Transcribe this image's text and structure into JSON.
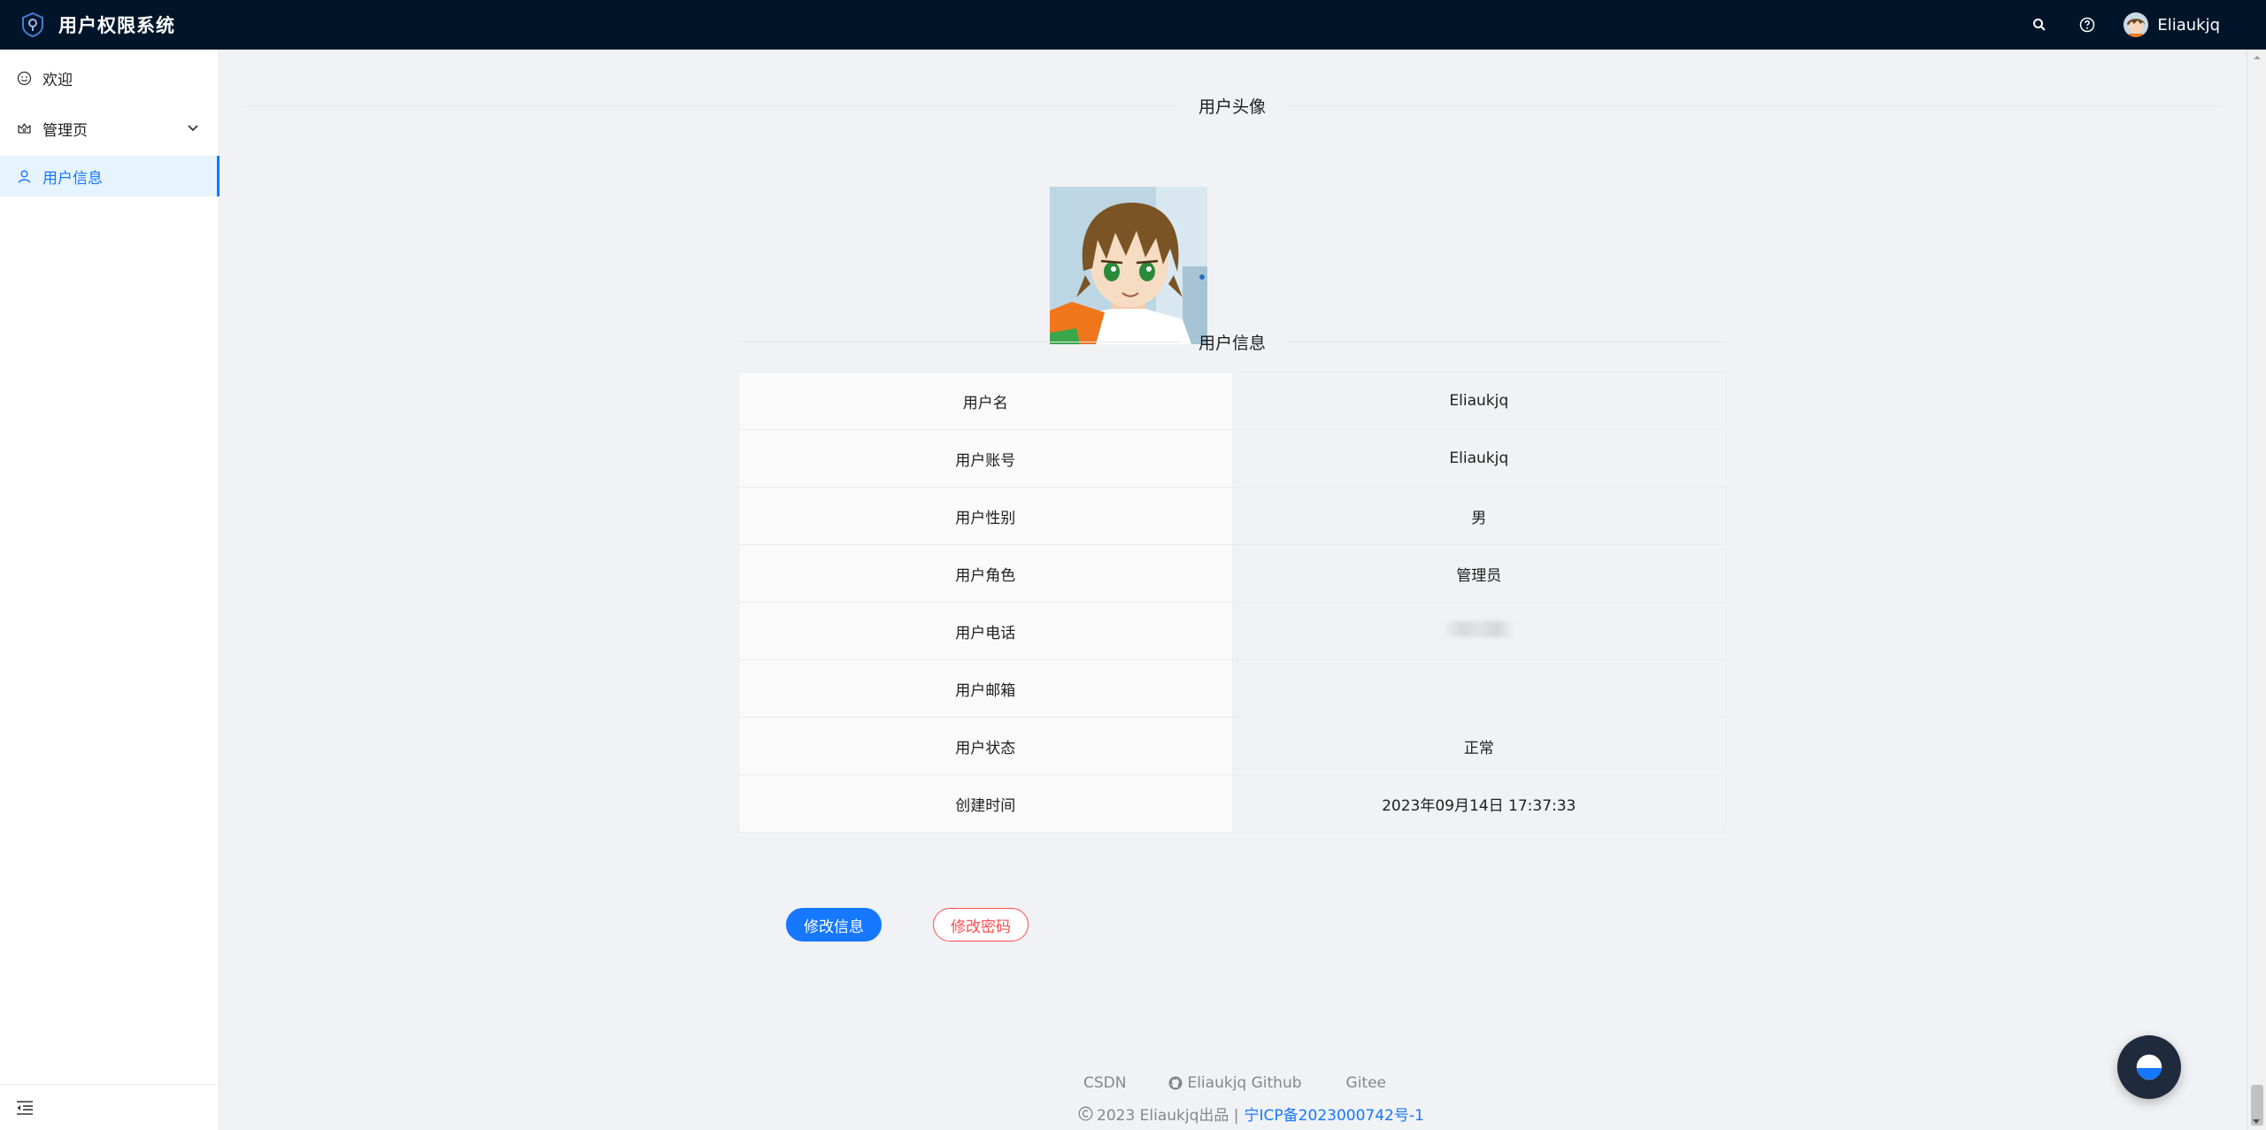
{
  "header": {
    "title": "用户权限系统",
    "icons": [
      "search-icon",
      "question-circle-icon"
    ],
    "user_name": "Eliaukjq"
  },
  "sidebar": {
    "items": [
      {
        "label": "欢迎",
        "icon": "smile-icon",
        "active": false
      },
      {
        "label": "管理页",
        "icon": "crown-icon",
        "active": false,
        "expandable": true
      },
      {
        "label": "用户信息",
        "icon": "user-icon",
        "active": true
      }
    ],
    "collapse_icon": "menu-fold-icon"
  },
  "main": {
    "avatar_divider": "用户头像",
    "info_divider": "用户信息",
    "rows": [
      {
        "label": "用户名",
        "value": "Eliaukjq"
      },
      {
        "label": "用户账号",
        "value": "Eliaukjq"
      },
      {
        "label": "用户性别",
        "value": "男"
      },
      {
        "label": "用户角色",
        "value": "管理员"
      },
      {
        "label": "用户电话",
        "value": "",
        "blurred": true
      },
      {
        "label": "用户邮箱",
        "value": ""
      },
      {
        "label": "用户状态",
        "value": "正常"
      },
      {
        "label": "创建时间",
        "value": "2023年09月14日 17:37:33"
      }
    ],
    "edit_info_button": "修改信息",
    "edit_password_button": "修改密码"
  },
  "footer": {
    "links": [
      "CSDN",
      "Eliaukjq Github",
      "Gitee"
    ],
    "copyright": "2023 Eliaukjq出品 |",
    "icp": "宁ICP备2023000742号-1"
  },
  "colors": {
    "header_bg": "#001529",
    "primary": "#1677ff",
    "danger": "#ff4d4f",
    "active_bg": "#e6f4ff"
  }
}
